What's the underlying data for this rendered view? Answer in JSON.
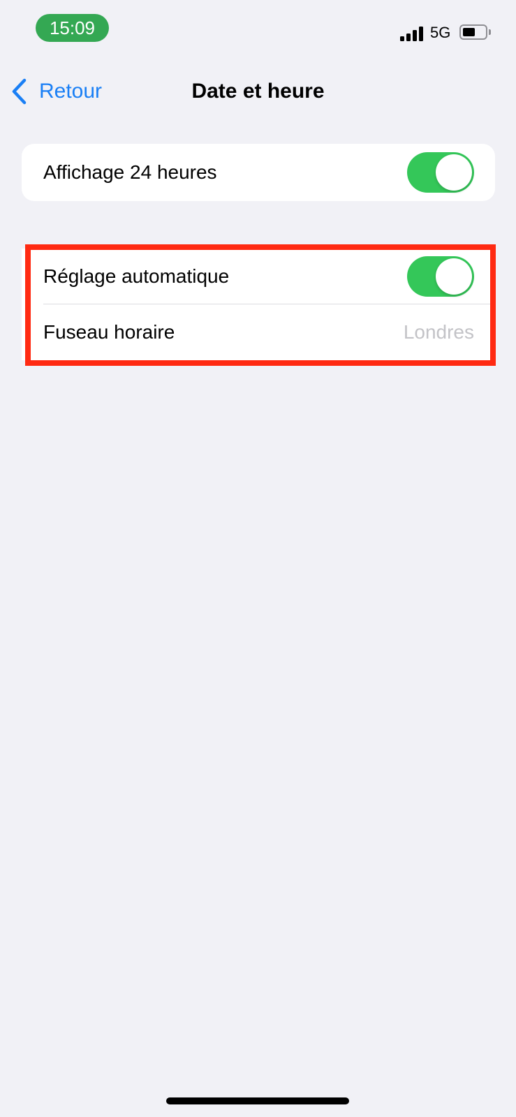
{
  "status_bar": {
    "time": "15:09",
    "network": "5G",
    "signal_icon": "cellular-signal-icon",
    "battery_icon": "battery-icon",
    "battery_level": 0.5
  },
  "nav": {
    "back_label": "Retour",
    "back_icon": "chevron-left-icon",
    "title": "Date et heure"
  },
  "settings": {
    "time_format": {
      "label": "Affichage 24 heures",
      "enabled": true
    },
    "auto_set": {
      "label": "Réglage automatique",
      "enabled": true
    },
    "timezone": {
      "label": "Fuseau horaire",
      "value": "Londres"
    }
  },
  "colors": {
    "accent_blue": "#1a7ff5",
    "toggle_on": "#34c759",
    "time_pill": "#34a853",
    "highlight": "#ff2a12",
    "background": "#f1f1f6"
  }
}
